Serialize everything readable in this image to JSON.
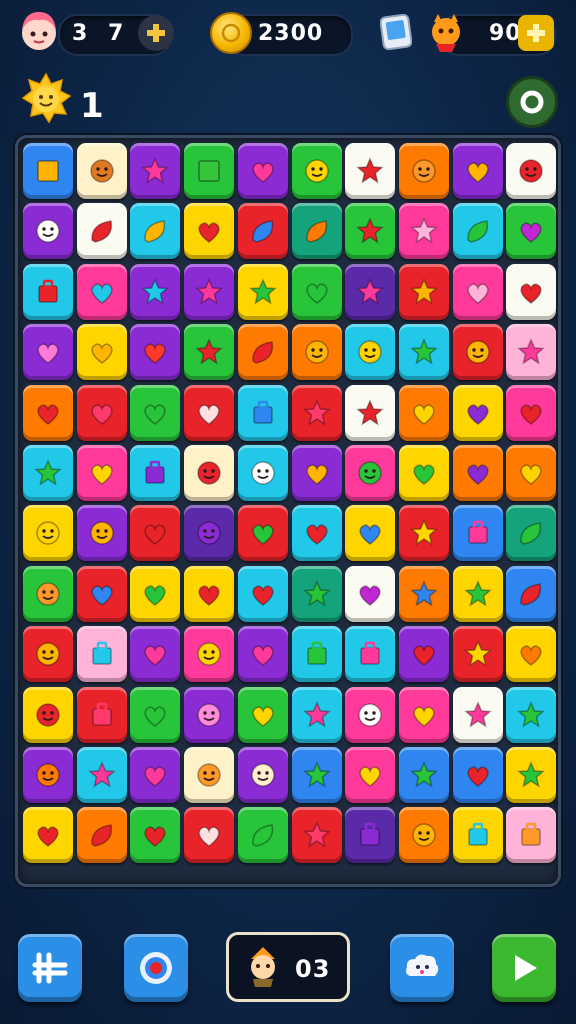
{
  "hud": {
    "lives": "3",
    "moves": "7",
    "coins": "2300",
    "gems": "90",
    "level": "1"
  },
  "counter": {
    "value": "03"
  },
  "colors": {
    "orange": "#ff7a00",
    "yellow": "#ffd500",
    "cream": "#fff2c9",
    "green": "#28c43a",
    "purple": "#8a2bd4",
    "blue": "#2f86f0",
    "cyan": "#22c8e8",
    "red": "#e8232a",
    "pink": "#ff3a9a",
    "lightpink": "#ffb3d9",
    "teal": "#14a37a",
    "darkpurple": "#5a2aa8",
    "white": "#fbfbf2",
    "lime": "#7ed321"
  },
  "board": {
    "rows": [
      [
        [
          "blue",
          "square",
          "#ffb400"
        ],
        [
          "cream",
          "face",
          "#e07a20"
        ],
        [
          "purple",
          "star",
          "#ff3a9a"
        ],
        [
          "green",
          "square",
          "#36c43a"
        ],
        [
          "purple",
          "heart",
          "#ff3a9a"
        ],
        [
          "green",
          "face",
          "#ffd500"
        ],
        [
          "white",
          "star",
          "#e8232a"
        ],
        [
          "orange",
          "face",
          "#ff9a2a"
        ],
        [
          "purple",
          "heart",
          "#ffb400"
        ],
        [
          "white",
          "face",
          "#e8232a"
        ]
      ],
      [
        [
          "purple",
          "face",
          "#ffffff"
        ],
        [
          "white",
          "leaf",
          "#e8232a"
        ],
        [
          "cyan",
          "leaf",
          "#ffb400"
        ],
        [
          "yellow",
          "heart",
          "#e8232a"
        ],
        [
          "red",
          "leaf",
          "#2f86f0"
        ],
        [
          "teal",
          "leaf",
          "#ff7a00"
        ],
        [
          "green",
          "star",
          "#e8232a"
        ],
        [
          "pink",
          "star",
          "#ffb3d9"
        ],
        [
          "cyan",
          "leaf",
          "#28c43a"
        ],
        [
          "green",
          "heart",
          "#c026d3"
        ]
      ],
      [
        [
          "cyan",
          "box",
          "#e8232a"
        ],
        [
          "pink",
          "heart",
          "#22c8e8"
        ],
        [
          "purple",
          "star",
          "#22c8e8"
        ],
        [
          "purple",
          "star",
          "#ff3a9a"
        ],
        [
          "yellow",
          "star",
          "#28c43a"
        ],
        [
          "green",
          "heart",
          "#28c43a"
        ],
        [
          "darkpurple",
          "star",
          "#ff3a9a"
        ],
        [
          "red",
          "star",
          "#ffb400"
        ],
        [
          "pink",
          "heart",
          "#ffb3d9"
        ],
        [
          "white",
          "heart",
          "#e8232a"
        ]
      ],
      [
        [
          "purple",
          "heart",
          "#ff7ad9"
        ],
        [
          "yellow",
          "heart",
          "#ffb400"
        ],
        [
          "purple",
          "heart",
          "#ff3a2a"
        ],
        [
          "green",
          "star",
          "#e8232a"
        ],
        [
          "orange",
          "leaf",
          "#e8232a"
        ],
        [
          "orange",
          "face",
          "#ffb400"
        ],
        [
          "cyan",
          "face",
          "#ffd500"
        ],
        [
          "cyan",
          "star",
          "#28c43a"
        ],
        [
          "red",
          "face",
          "#ffb400"
        ],
        [
          "lightpink",
          "star",
          "#ff3a9a"
        ]
      ],
      [
        [
          "orange",
          "heart",
          "#e8232a"
        ],
        [
          "red",
          "heart",
          "#ff3a6a"
        ],
        [
          "green",
          "heart",
          "#28c43a"
        ],
        [
          "red",
          "heart",
          "#ffe0e0"
        ],
        [
          "cyan",
          "box",
          "#2f86f0"
        ],
        [
          "red",
          "star",
          "#ff3a6a"
        ],
        [
          "white",
          "star",
          "#e8232a"
        ],
        [
          "orange",
          "heart",
          "#ffd500"
        ],
        [
          "yellow",
          "heart",
          "#8a2bd4"
        ],
        [
          "pink",
          "heart",
          "#e8232a"
        ]
      ],
      [
        [
          "cyan",
          "star",
          "#28c43a"
        ],
        [
          "pink",
          "heart",
          "#ffd500"
        ],
        [
          "cyan",
          "box",
          "#8a2bd4"
        ],
        [
          "cream",
          "face",
          "#e8232a"
        ],
        [
          "cyan",
          "face",
          "#ffffff"
        ],
        [
          "purple",
          "heart",
          "#ffb400"
        ],
        [
          "pink",
          "face",
          "#28c43a"
        ],
        [
          "yellow",
          "heart",
          "#28c43a"
        ],
        [
          "orange",
          "heart",
          "#8a2bd4"
        ],
        [
          "orange",
          "heart",
          "#ffd500"
        ]
      ],
      [
        [
          "yellow",
          "face",
          "#ffd500"
        ],
        [
          "purple",
          "face",
          "#ffb400"
        ],
        [
          "red",
          "heart",
          "#e8232a"
        ],
        [
          "darkpurple",
          "face",
          "#8a2bd4"
        ],
        [
          "red",
          "heart",
          "#28c43a"
        ],
        [
          "cyan",
          "heart",
          "#e8232a"
        ],
        [
          "yellow",
          "heart",
          "#2f86f0"
        ],
        [
          "red",
          "star",
          "#ffd500"
        ],
        [
          "blue",
          "box",
          "#ff3a9a"
        ],
        [
          "teal",
          "leaf",
          "#28c43a"
        ]
      ],
      [
        [
          "green",
          "face",
          "#ff9a2a"
        ],
        [
          "red",
          "heart",
          "#2f86f0"
        ],
        [
          "yellow",
          "heart",
          "#28c43a"
        ],
        [
          "yellow",
          "heart",
          "#e8232a"
        ],
        [
          "cyan",
          "heart",
          "#e8232a"
        ],
        [
          "teal",
          "star",
          "#28c43a"
        ],
        [
          "white",
          "heart",
          "#c026d3"
        ],
        [
          "orange",
          "star",
          "#2f86f0"
        ],
        [
          "yellow",
          "star",
          "#28c43a"
        ],
        [
          "blue",
          "leaf",
          "#e8232a"
        ]
      ],
      [
        [
          "red",
          "face",
          "#ffb400"
        ],
        [
          "lightpink",
          "box",
          "#22c8e8"
        ],
        [
          "purple",
          "heart",
          "#ff3a9a"
        ],
        [
          "pink",
          "face",
          "#ffd500"
        ],
        [
          "purple",
          "heart",
          "#ff3a9a"
        ],
        [
          "cyan",
          "box",
          "#28c43a"
        ],
        [
          "cyan",
          "box",
          "#ff3a9a"
        ],
        [
          "purple",
          "heart",
          "#e8232a"
        ],
        [
          "red",
          "star",
          "#ffd500"
        ],
        [
          "yellow",
          "heart",
          "#ff7a00"
        ]
      ],
      [
        [
          "yellow",
          "face",
          "#e8232a"
        ],
        [
          "red",
          "box",
          "#ff3a6a"
        ],
        [
          "green",
          "heart",
          "#28c43a"
        ],
        [
          "purple",
          "face",
          "#ff8ad9"
        ],
        [
          "green",
          "heart",
          "#ffd500"
        ],
        [
          "cyan",
          "star",
          "#ff3a9a"
        ],
        [
          "pink",
          "face",
          "#ffffff"
        ],
        [
          "pink",
          "heart",
          "#ffd500"
        ],
        [
          "white",
          "star",
          "#ff3a9a"
        ],
        [
          "cyan",
          "star",
          "#28c43a"
        ]
      ],
      [
        [
          "purple",
          "face",
          "#ff7a00"
        ],
        [
          "cyan",
          "star",
          "#ff3a9a"
        ],
        [
          "purple",
          "heart",
          "#ff3a9a"
        ],
        [
          "cream",
          "face",
          "#ff9a2a"
        ],
        [
          "purple",
          "face",
          "#ffeecc"
        ],
        [
          "blue",
          "star",
          "#28c43a"
        ],
        [
          "pink",
          "heart",
          "#ffd500"
        ],
        [
          "blue",
          "star",
          "#28c43a"
        ],
        [
          "blue",
          "heart",
          "#e8232a"
        ],
        [
          "yellow",
          "star",
          "#28c43a"
        ]
      ],
      [
        [
          "yellow",
          "heart",
          "#e8232a"
        ],
        [
          "orange",
          "leaf",
          "#e8232a"
        ],
        [
          "green",
          "heart",
          "#e8232a"
        ],
        [
          "red",
          "heart",
          "#ffe0e0"
        ],
        [
          "green",
          "leaf",
          "#28c43a"
        ],
        [
          "red",
          "star",
          "#ff3a6a"
        ],
        [
          "darkpurple",
          "box",
          "#8a2bd4"
        ],
        [
          "orange",
          "face",
          "#ffb400"
        ],
        [
          "yellow",
          "box",
          "#22c8e8"
        ],
        [
          "lightpink",
          "box",
          "#ff9a2a"
        ]
      ]
    ]
  }
}
